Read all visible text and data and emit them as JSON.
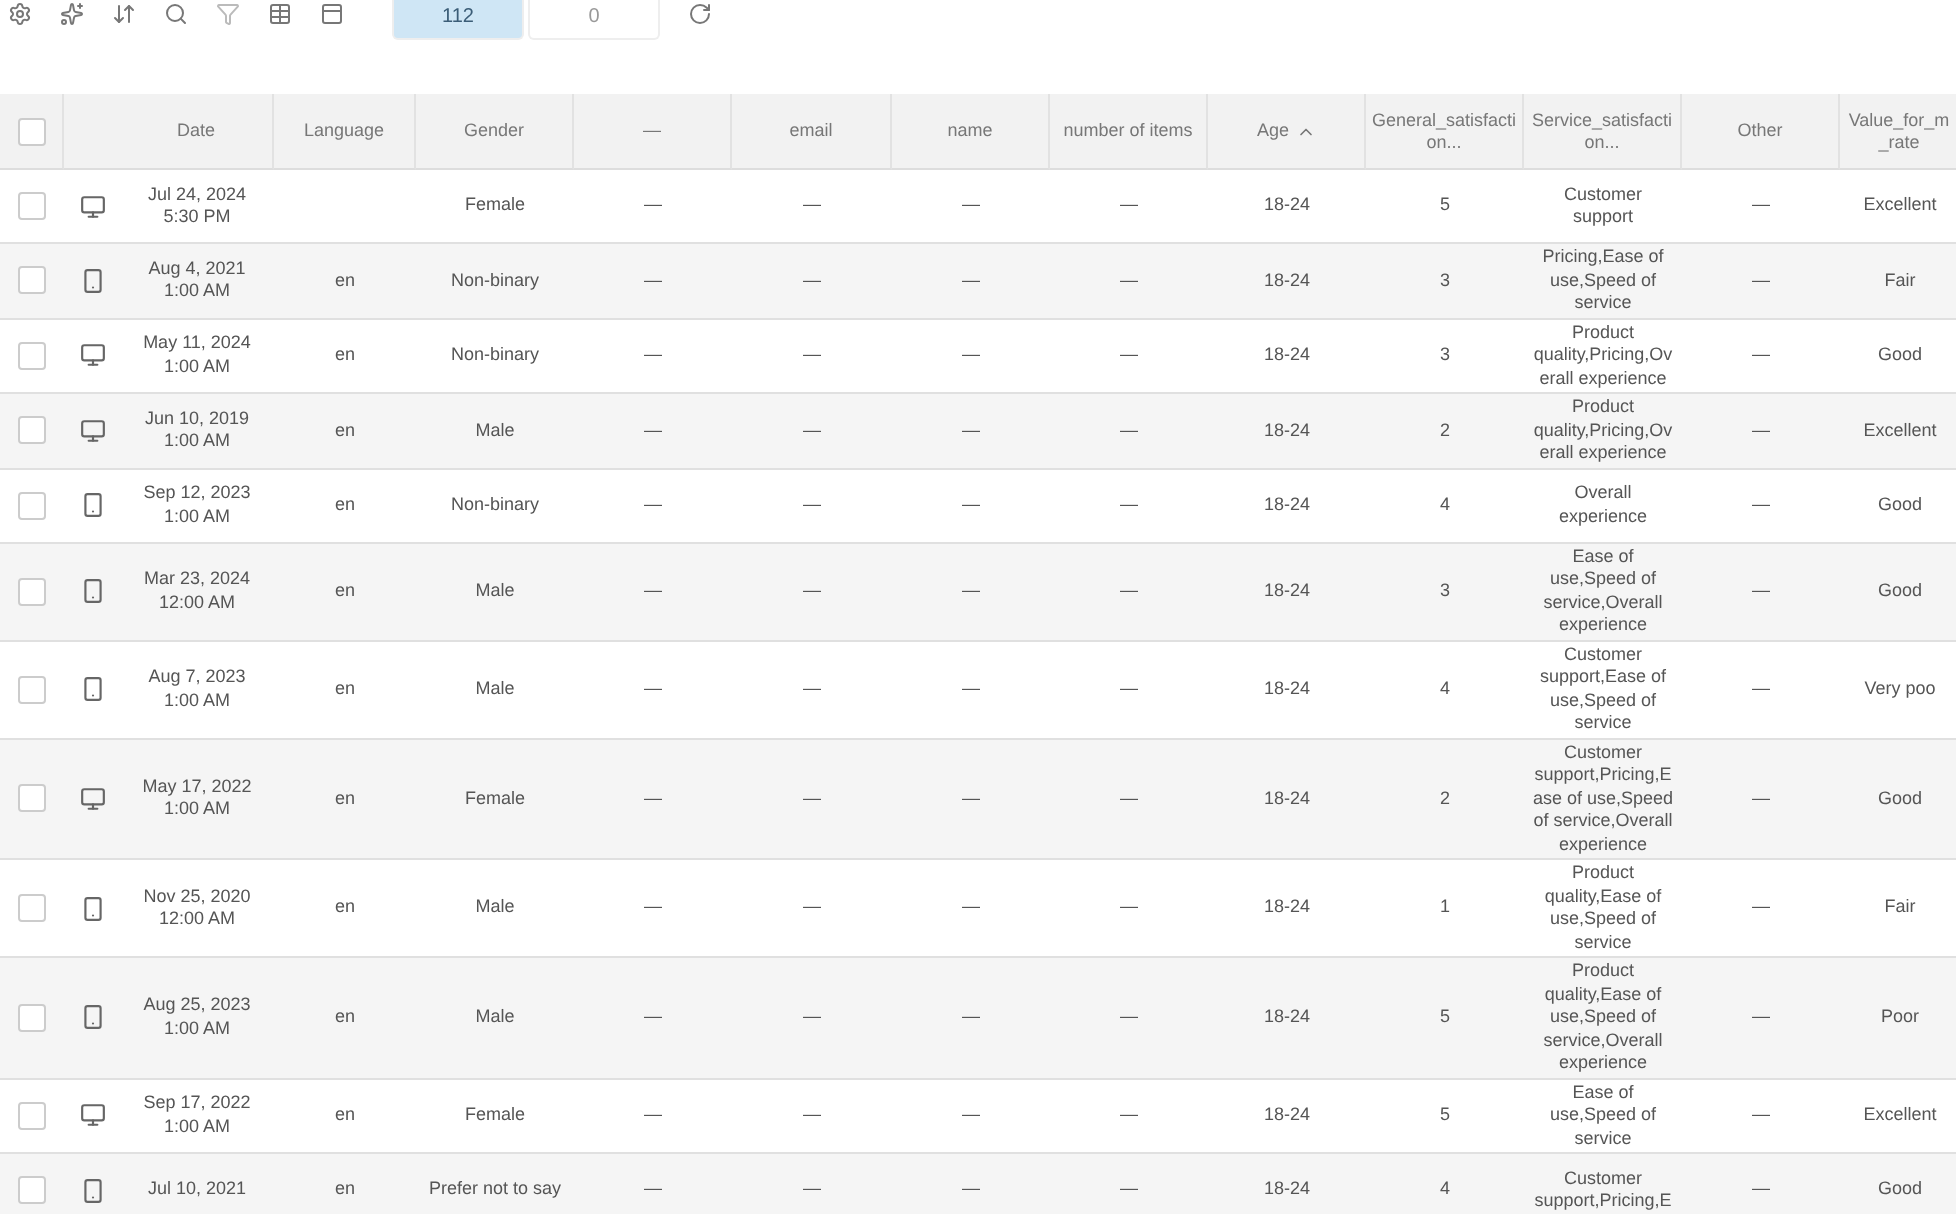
{
  "toolbar": {
    "tabs": [
      {
        "count": "112",
        "selected": true
      },
      {
        "count": "0",
        "selected": false
      }
    ]
  },
  "table": {
    "all_checked": false,
    "columns": [
      {
        "kind": "check"
      },
      {
        "kind": "device"
      },
      {
        "label": "Date"
      },
      {
        "label": "Language"
      },
      {
        "label": "Gender"
      },
      {
        "label": "—"
      },
      {
        "label": "email"
      },
      {
        "label": "name"
      },
      {
        "label": "number of items"
      },
      {
        "label": "Age",
        "sorted": true
      },
      {
        "label": "General_satisfaction..."
      },
      {
        "label": "Service_satisfaction..."
      },
      {
        "label": "Other"
      },
      {
        "label": "Value_for_m_rate"
      }
    ],
    "rows": [
      {
        "checked": false,
        "kind": "desktop",
        "date": "Jul 24, 2024",
        "time": "5:30 PM",
        "language": "",
        "gender": "Female",
        "c1": "—",
        "email": "—",
        "name": "—",
        "items": "—",
        "age": "18-24",
        "general": "5",
        "service": "Customer support",
        "other": "—",
        "value": "Excellent"
      },
      {
        "checked": false,
        "kind": "mobile",
        "date": "Aug 4, 2021",
        "time": "1:00 AM",
        "language": "en",
        "gender": "Non-binary",
        "c1": "—",
        "email": "—",
        "name": "—",
        "items": "—",
        "age": "18-24",
        "general": "3",
        "service": "Pricing,Ease of use,Speed of service",
        "other": "—",
        "value": "Fair"
      },
      {
        "checked": false,
        "kind": "desktop",
        "date": "May 11, 2024",
        "time": "1:00 AM",
        "language": "en",
        "gender": "Non-binary",
        "c1": "—",
        "email": "—",
        "name": "—",
        "items": "—",
        "age": "18-24",
        "general": "3",
        "service": "Product quality,Pricing,Overall experience",
        "other": "—",
        "value": "Good"
      },
      {
        "checked": false,
        "kind": "desktop",
        "date": "Jun 10, 2019",
        "time": "1:00 AM",
        "language": "en",
        "gender": "Male",
        "c1": "—",
        "email": "—",
        "name": "—",
        "items": "—",
        "age": "18-24",
        "general": "2",
        "service": "Product quality,Pricing,Overall experience",
        "other": "—",
        "value": "Excellent"
      },
      {
        "checked": false,
        "kind": "mobile",
        "date": "Sep 12, 2023",
        "time": "1:00 AM",
        "language": "en",
        "gender": "Non-binary",
        "c1": "—",
        "email": "—",
        "name": "—",
        "items": "—",
        "age": "18-24",
        "general": "4",
        "service": "Overall experience",
        "other": "—",
        "value": "Good"
      },
      {
        "checked": false,
        "kind": "mobile",
        "date": "Mar 23, 2024",
        "time": "12:00 AM",
        "language": "en",
        "gender": "Male",
        "c1": "—",
        "email": "—",
        "name": "—",
        "items": "—",
        "age": "18-24",
        "general": "3",
        "service": "Ease of use,Speed of service,Overall experience",
        "other": "—",
        "value": "Good"
      },
      {
        "checked": false,
        "kind": "mobile",
        "date": "Aug 7, 2023",
        "time": "1:00 AM",
        "language": "en",
        "gender": "Male",
        "c1": "—",
        "email": "—",
        "name": "—",
        "items": "—",
        "age": "18-24",
        "general": "4",
        "service": "Customer support,Ease of use,Speed of service",
        "other": "—",
        "value": "Very poo"
      },
      {
        "checked": false,
        "kind": "desktop",
        "date": "May 17, 2022",
        "time": "1:00 AM",
        "language": "en",
        "gender": "Female",
        "c1": "—",
        "email": "—",
        "name": "—",
        "items": "—",
        "age": "18-24",
        "general": "2",
        "service": "Customer support,Pricing,Ease of use,Speed of service,Overall experience",
        "other": "—",
        "value": "Good"
      },
      {
        "checked": false,
        "kind": "mobile",
        "date": "Nov 25, 2020",
        "time": "12:00 AM",
        "language": "en",
        "gender": "Male",
        "c1": "—",
        "email": "—",
        "name": "—",
        "items": "—",
        "age": "18-24",
        "general": "1",
        "service": "Product quality,Ease of use,Speed of service",
        "other": "—",
        "value": "Fair"
      },
      {
        "checked": false,
        "kind": "mobile",
        "date": "Aug 25, 2023",
        "time": "1:00 AM",
        "language": "en",
        "gender": "Male",
        "c1": "—",
        "email": "—",
        "name": "—",
        "items": "—",
        "age": "18-24",
        "general": "5",
        "service": "Product quality,Ease of use,Speed of service,Overall experience",
        "other": "—",
        "value": "Poor"
      },
      {
        "checked": false,
        "kind": "desktop",
        "date": "Sep 17, 2022",
        "time": "1:00 AM",
        "language": "en",
        "gender": "Female",
        "c1": "—",
        "email": "—",
        "name": "—",
        "items": "—",
        "age": "18-24",
        "general": "5",
        "service": "Ease of use,Speed of service",
        "other": "—",
        "value": "Excellent"
      },
      {
        "checked": false,
        "kind": "mobile",
        "date": "Jul 10, 2021",
        "language": "en",
        "gender": "Prefer not to say",
        "c1": "—",
        "email": "—",
        "name": "—",
        "items": "—",
        "age": "18-24",
        "general": "4",
        "service": "Customer support,Pricing,E",
        "other": "—",
        "value": "Good"
      }
    ]
  }
}
